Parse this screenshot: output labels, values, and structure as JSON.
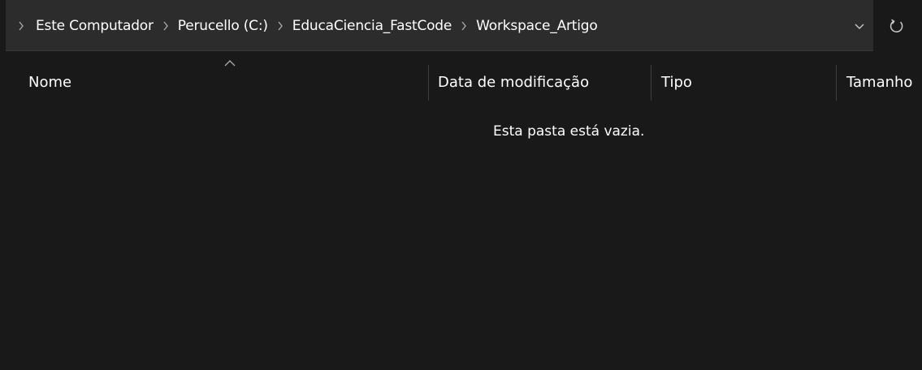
{
  "address_bar": {
    "breadcrumbs": [
      {
        "label": "Este Computador"
      },
      {
        "label": "Perucello (C:)"
      },
      {
        "label": "EducaCiencia_FastCode"
      },
      {
        "label": "Workspace_Artigo"
      }
    ],
    "dropdown_icon": "chevron-down-icon",
    "refresh_icon": "refresh-icon"
  },
  "columns": {
    "name": "Nome",
    "date_modified": "Data de modificação",
    "type": "Tipo",
    "size": "Tamanho",
    "sort_indicator": "chevron-up-icon"
  },
  "content": {
    "empty_message": "Esta pasta está vazia."
  },
  "colors": {
    "background": "#191919",
    "address_field": "#2c2c2c",
    "text": "#ffffff",
    "muted": "#9a9a9a"
  }
}
